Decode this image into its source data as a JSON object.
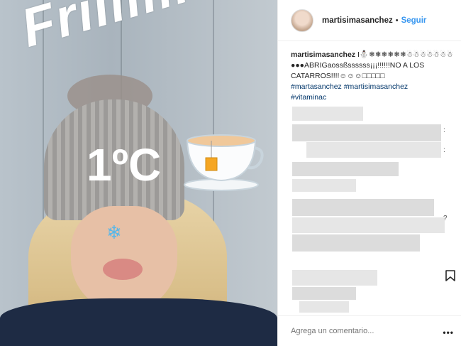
{
  "photo": {
    "scrawl_text": "Friiiiiiio!!",
    "temperature": "1ºC",
    "snowflake_icon": "snowflake",
    "cup_icon": "tea-cup",
    "colors": {
      "sweater": "#1e2b44",
      "hat": "#a9a7a4"
    }
  },
  "header": {
    "username": "martisimasanchez",
    "separator": "•",
    "follow_label": "Seguir"
  },
  "caption": {
    "username": "martisimasanchez",
    "text": "I⛄❄❄❄❄❄❄☃☃☃☃☃☃☃●●●ABRIGaossßssssss¡¡¡!!!!!!NO A LOS CATARROS!!!!☺☺☺□□□□□",
    "tags_line1": "#martasanchez #martisimasanchez",
    "tags_line2": "#vitaminac"
  },
  "edges": {
    "a": ":",
    "b": ":",
    "c": "?"
  },
  "footer": {
    "comment_placeholder": "Agrega un comentario...",
    "more_label": "•••"
  },
  "icons": {
    "bookmark": "bookmark-icon"
  }
}
